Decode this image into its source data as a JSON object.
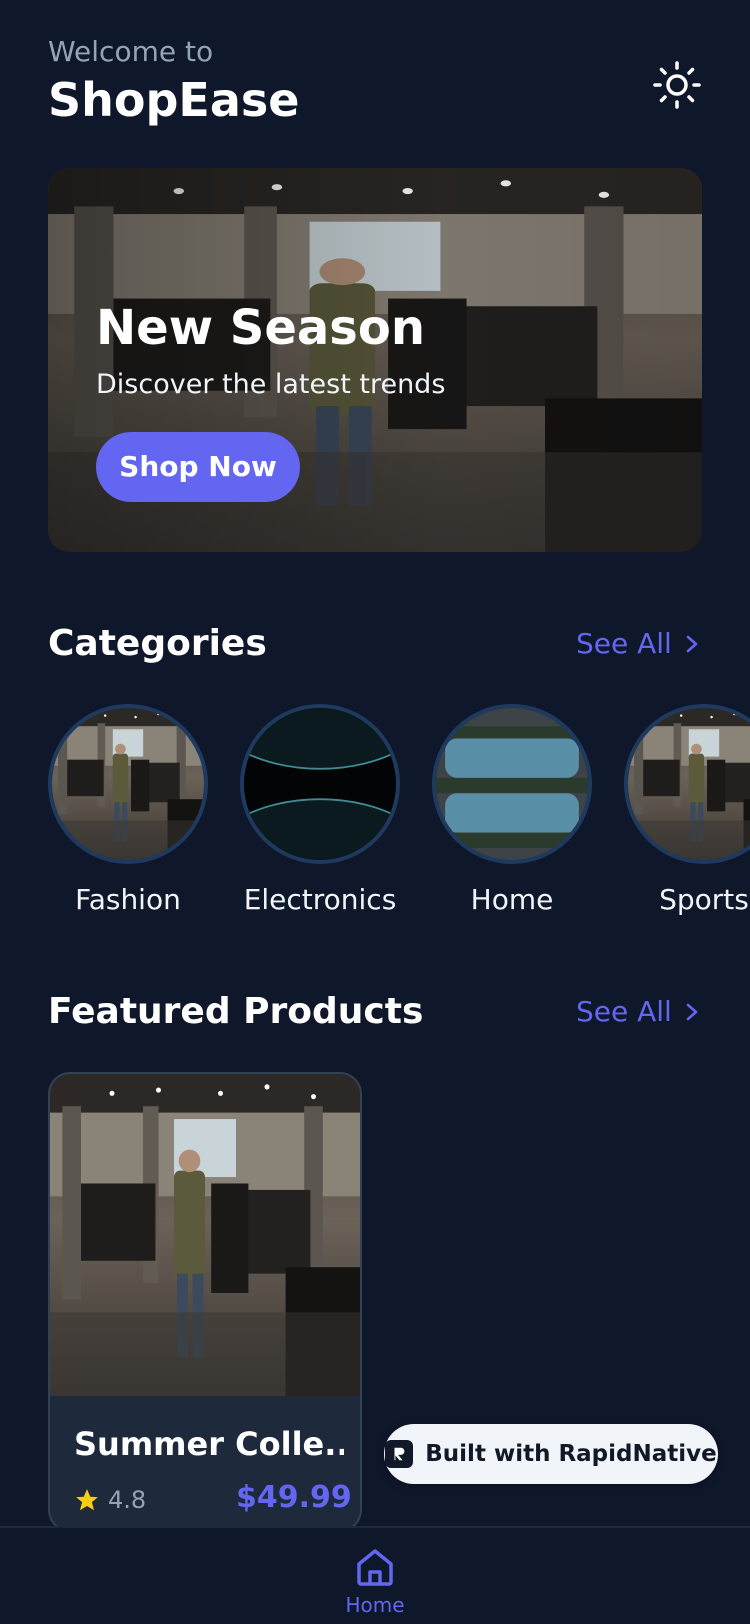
{
  "header": {
    "welcome": "Welcome to",
    "brand": "ShopEase",
    "theme_icon": "sun-icon"
  },
  "hero": {
    "title": "New Season",
    "subtitle": "Discover the latest trends",
    "cta": "Shop Now"
  },
  "categories_section": {
    "title": "Categories",
    "see_all": "See All",
    "items": [
      {
        "label": "Fashion"
      },
      {
        "label": "Electronics"
      },
      {
        "label": "Home"
      },
      {
        "label": "Sports"
      }
    ]
  },
  "featured_section": {
    "title": "Featured Products",
    "see_all": "See All",
    "products": [
      {
        "name": "Summer Colle...",
        "rating": "4.8",
        "price": "$49.99"
      }
    ]
  },
  "badge": {
    "label": "Built with RapidNative"
  },
  "tabbar": {
    "home_label": "Home",
    "home_icon": "home-icon"
  },
  "colors": {
    "background": "#0f172a",
    "accent": "#6366f1",
    "card": "#1e293b",
    "muted": "#94a3b8",
    "star": "#facc15"
  }
}
